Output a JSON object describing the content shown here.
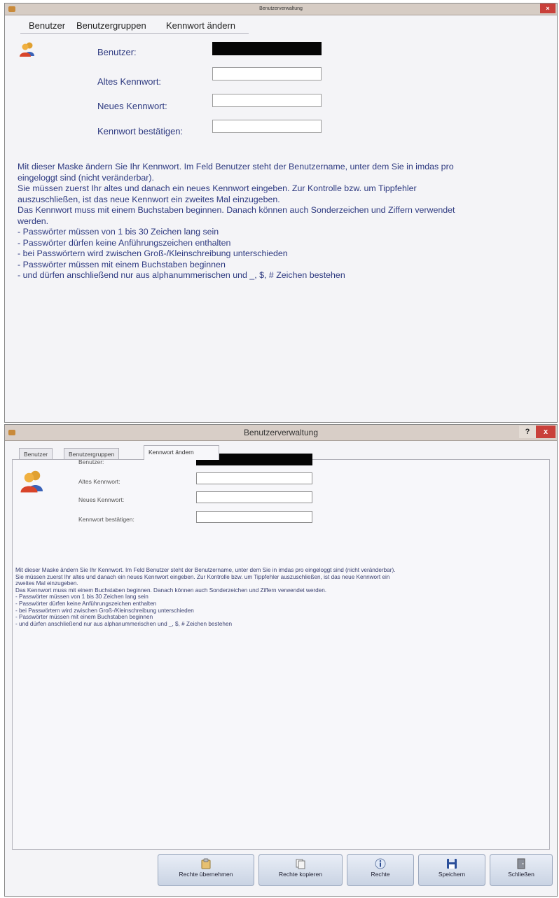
{
  "window1": {
    "title": "Benutzerverwaltung",
    "close_label": "×",
    "tabs": [
      "Benutzer",
      "Benutzergruppen",
      "Kennwort ändern"
    ],
    "form": {
      "user_label": "Benutzer:",
      "old_pw_label": "Altes Kennwort:",
      "new_pw_label": "Neues Kennwort:",
      "confirm_pw_label": "Kennwort bestätigen:"
    },
    "description": [
      "Mit dieser Maske ändern Sie Ihr Kennwort. Im Feld Benutzer steht der Benutzername, unter dem Sie in imdas pro",
      "eingeloggt sind (nicht veränderbar).",
      "Sie müssen zuerst Ihr altes und danach ein neues Kennwort eingeben. Zur Kontrolle bzw. um Tippfehler",
      "auszuschließen, ist das neue Kennwort ein zweites Mal einzugeben.",
      "Das Kennwort muss mit einem Buchstaben beginnen. Danach können auch Sonderzeichen und Ziffern verwendet",
      "werden.",
      "- Passwörter müssen von 1 bis 30 Zeichen lang sein",
      "- Passwörter dürfen keine Anführungszeichen enthalten",
      "- bei Passwörtern wird zwischen Groß-/Kleinschreibung unterschieden",
      "- Passwörter müssen mit einem Buchstaben beginnen",
      "- und dürfen anschließend nur aus alphanummerischen und _, $, # Zeichen bestehen"
    ]
  },
  "window2": {
    "title": "Benutzerverwaltung",
    "help_label": "?",
    "close_label": "x",
    "tabs": [
      "Benutzer",
      "Benutzergruppen",
      "Kennwort ändern"
    ],
    "active_tab": "Kennwort ändern",
    "form": {
      "user_label": "Benutzer:",
      "old_pw_label": "Altes Kennwort:",
      "new_pw_label": "Neues Kennwort:",
      "confirm_pw_label": "Kennwort bestätigen:"
    },
    "description": [
      "Mit dieser Maske ändern Sie Ihr Kennwort. Im Feld Benutzer steht der Benutzername, unter dem Sie in imdas pro eingeloggt sind (nicht veränderbar).",
      "Sie müssen zuerst Ihr altes und danach ein neues Kennwort eingeben. Zur Kontrolle bzw. um Tippfehler auszuschließen, ist das neue Kennwort ein",
      "zweites Mal einzugeben.",
      "Das Kennwort muss mit einem Buchstaben beginnen. Danach können auch Sonderzeichen und Ziffern verwendet werden.",
      "- Passwörter müssen von 1 bis 30 Zeichen lang sein",
      "- Passwörter dürfen keine Anführungszeichen enthalten",
      "- bei Passwörtern wird zwischen Groß-/Kleinschreibung unterschieden",
      "- Passwörter müssen mit einem Buchstaben beginnen",
      "- und dürfen anschließend nur aus alphanummerischen und _, $, # Zeichen bestehen"
    ],
    "buttons": {
      "apply_rights": "Rechte übernehmen",
      "copy_rights": "Rechte kopieren",
      "rights": "Rechte",
      "save": "Speichern",
      "close": "Schließen"
    }
  },
  "colors": {
    "label_blue": "#2e3a80",
    "titlebar": "#d6ccc4",
    "close_red": "#c9403a"
  }
}
